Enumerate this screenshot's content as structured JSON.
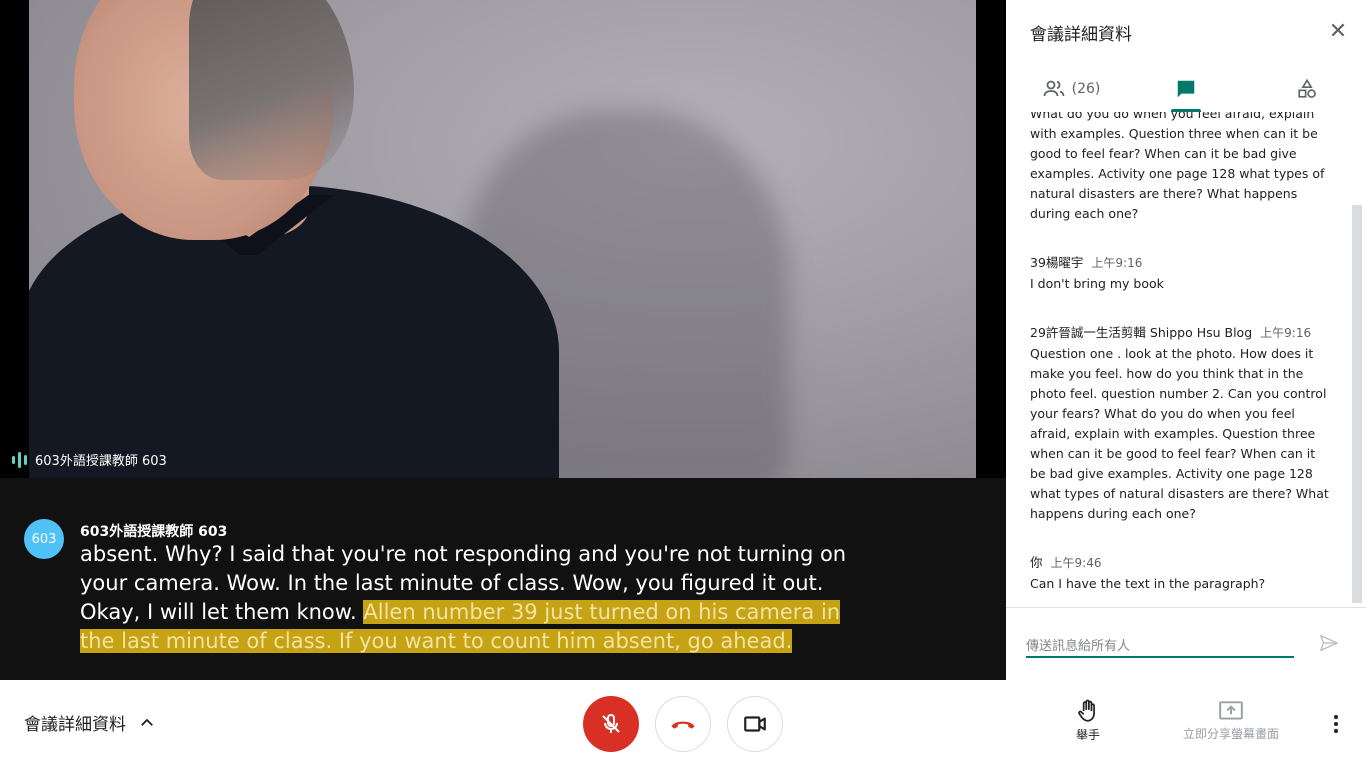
{
  "video": {
    "participant_label": "603外語授課教師 603"
  },
  "caption": {
    "avatar_text": "603",
    "speaker": "603外語授課教師 603",
    "text_plain": "absent. Why? I said that you're not responding and you're not turning on your camera. Wow. In the last minute of class. Wow, you figured it out. Okay, I will let them know. ",
    "text_highlight": "Allen number 39 just turned on his camera in the last minute of class. If you want to count him absent, go ahead."
  },
  "panel": {
    "title": "會議詳細資料",
    "close_icon": "close-icon",
    "tabs": {
      "people_count": "(26)",
      "people_icon": "people-icon",
      "chat_icon": "chat-icon",
      "activities_icon": "shapes-icon"
    },
    "messages": [
      {
        "sender": "",
        "time": "",
        "text": "What do you do when you feel afraid, explain with examples. Question three when can it be good to feel fear? When can it be bad give examples. Activity one page 128 what types of natural disasters are there? What happens during each one?"
      },
      {
        "sender": "39楊曜宇",
        "time": "上午9:16",
        "text": "I don't bring my book"
      },
      {
        "sender": "29許晉誠一生活剪輯 Shippo Hsu Blog",
        "time": "上午9:16",
        "text": "Question one . look at the photo. How does it make you feel. how do you think that in the photo feel. question number 2. Can you control your fears? What do you do when you feel afraid, explain with examples. Question three when can it be good to feel fear? When can it be bad give examples. Activity one page 128 what types of natural disasters are there? What happens during each one?"
      },
      {
        "sender": "你",
        "time": "上午9:46",
        "text": "Can I have the text in the paragraph?"
      }
    ],
    "input_placeholder": "傳送訊息給所有人",
    "accent_color": "#00796b"
  },
  "bottombar": {
    "details_label": "會議詳細資料",
    "raise_hand_label": "舉手",
    "present_label": "立即分享螢幕畫面",
    "mic_color": "#d93025",
    "hangup_color": "#d93025"
  }
}
